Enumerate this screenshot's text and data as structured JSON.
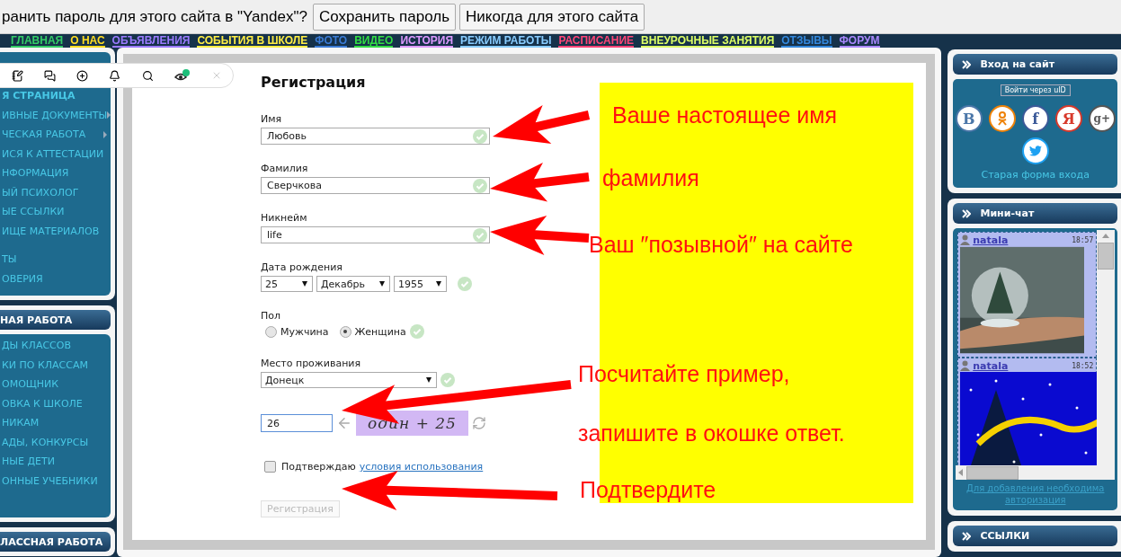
{
  "password_bar": {
    "prompt": "ранить пароль для этого сайта в \"Yandex\"?",
    "buttons": [
      "Сохранить пароль",
      "Никогда для этого сайта"
    ]
  },
  "nav": [
    {
      "label": "ГЛАВНАЯ",
      "color": "#33cc66"
    },
    {
      "label": "О НАС",
      "color": "#ffdd22"
    },
    {
      "label": "ОБЪЯВЛЕНИЯ",
      "color": "#9b7bff"
    },
    {
      "label": "СОБЫТИЯ В ШКОЛЕ",
      "color": "#ffee44"
    },
    {
      "label": "ФОТО",
      "color": "#3a7bd5"
    },
    {
      "label": "ВИДЕО",
      "color": "#33dd44"
    },
    {
      "label": "ИСТОРИЯ",
      "color": "#dd99ff"
    },
    {
      "label": "РЕЖИМ РАБОТЫ",
      "color": "#88ccff"
    },
    {
      "label": "РАСПИСАНИЕ",
      "color": "#ff4477"
    },
    {
      "label": "ВНЕУРОЧНЫЕ ЗАНЯТИЯ",
      "color": "#ddff66"
    },
    {
      "label": "ОТЗЫВЫ",
      "color": "#3388dd"
    },
    {
      "label": "ФОРУМ",
      "color": "#aa88ff"
    }
  ],
  "left_sidebar": {
    "menu": [
      {
        "label": "Я СТРАНИЦА",
        "has_submenu": false
      },
      {
        "label": "ИВНЫЕ ДОКУМЕНТЫ",
        "has_submenu": true
      },
      {
        "label": "ЧЕСКАЯ РАБОТА",
        "has_submenu": true
      },
      {
        "label": "ИСЯ К АТТЕСТАЦИИ",
        "has_submenu": false
      },
      {
        "label": "НФОРМАЦИЯ",
        "has_submenu": false
      },
      {
        "label": "ЫЙ ПСИХОЛОГ",
        "has_submenu": false
      },
      {
        "label": "ЫЕ ССЫЛКИ",
        "has_submenu": false
      },
      {
        "label": "ИЩЕ МАТЕРИАЛОВ",
        "has_submenu": false
      },
      {
        "label": "ТЫ",
        "has_submenu": false
      },
      {
        "label": "ОВЕРИЯ",
        "has_submenu": false
      }
    ],
    "panels": [
      {
        "title": "НАЯ РАБОТА",
        "items": [
          "ДЫ КЛАССОВ",
          "КИ ПО КЛАССАМ",
          "ОМОЩНИК",
          "ОВКА К ШКОЛЕ",
          "НИКАМ",
          "АДЫ, КОНКУРСЫ",
          "НЫЕ ДЕТИ",
          "ОННЫЕ УЧЕБНИКИ"
        ]
      },
      {
        "title": "ЛАССНАЯ РАБОТА"
      }
    ]
  },
  "form": {
    "title": "Регистрация",
    "fields": [
      {
        "label": "Имя",
        "value": "Любовь",
        "valid": true
      },
      {
        "label": "Фамилия",
        "value": "Сверчкова",
        "valid": true
      },
      {
        "label": "Никнейм",
        "value": "life",
        "valid": true
      }
    ],
    "birth_date": {
      "label": "Дата рождения",
      "day": "25",
      "month": "Декабрь",
      "year": "1955",
      "valid": true
    },
    "gender": {
      "label": "Пол",
      "valid": true,
      "options": [
        {
          "label": "Мужчина",
          "selected": false
        },
        {
          "label": "Женщина",
          "selected": true
        }
      ]
    },
    "residence": {
      "label": "Место проживания",
      "value": "Донецк",
      "valid": true
    },
    "captcha": {
      "answer": "26",
      "image_text": "один + 25"
    },
    "agree": {
      "checked": false,
      "text": "Подтверждаю",
      "link": "условия использования"
    },
    "submit": {
      "label": "Регистрация",
      "disabled": true
    }
  },
  "annotations": [
    {
      "text": "Ваше настоящее имя"
    },
    {
      "text": "фамилия"
    },
    {
      "text": "Ваш ″позывной″ на сайте"
    },
    {
      "text": "Посчитайте пример,"
    },
    {
      "text": "запишите в окошке ответ."
    },
    {
      "text": "Подтвердите"
    }
  ],
  "login": {
    "title": "Вход на сайт",
    "uid_button": "Войти через uID",
    "providers": [
      {
        "kind": "vk",
        "glyph": "В",
        "color": "#4a76a8"
      },
      {
        "kind": "ok",
        "color": "#ee8208"
      },
      {
        "kind": "fb",
        "glyph": "f",
        "color": "#3b5998"
      },
      {
        "kind": "ya",
        "glyph": "Я",
        "color": "#d8392b"
      },
      {
        "kind": "gplus",
        "glyph": "g+",
        "color": "#555555"
      },
      {
        "kind": "twitter",
        "color": "#1da1f2"
      }
    ],
    "old_form_link": "Старая форма входа"
  },
  "chat": {
    "title": "Мини-чат",
    "messages": [
      {
        "author": "natala",
        "time": "18:57",
        "kind": "globe"
      },
      {
        "author": "natala",
        "time": "18:52",
        "kind": "night"
      }
    ],
    "footer_link": "Для добавления необходима авторизация"
  },
  "links_panel": {
    "title": "ССЫЛКИ"
  }
}
